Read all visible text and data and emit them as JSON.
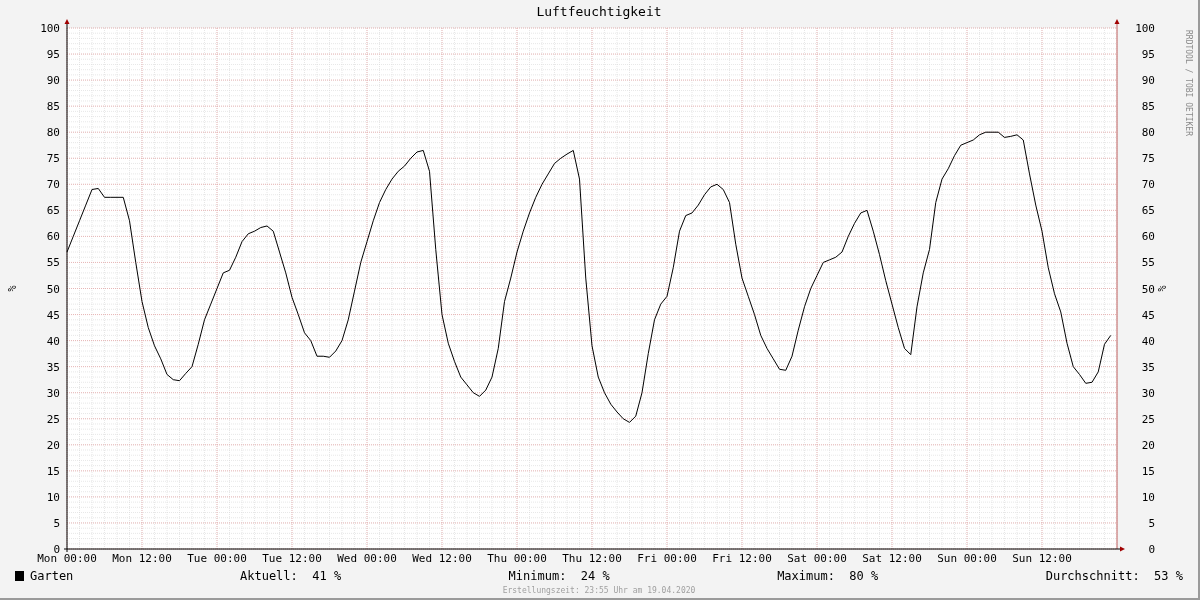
{
  "watermark": "RRDTOOL / TOBI OETIKER",
  "chart_data": {
    "type": "line",
    "title": "Luftfeuchtigkeit",
    "ylabel": "%",
    "ylim": [
      0,
      100
    ],
    "grid": true,
    "yticks": [
      0,
      5,
      10,
      15,
      20,
      25,
      30,
      35,
      40,
      45,
      50,
      55,
      60,
      65,
      70,
      75,
      80,
      85,
      90,
      95,
      100
    ],
    "categories": [
      "Mon 00:00",
      null,
      null,
      null,
      null,
      null,
      null,
      null,
      null,
      null,
      null,
      null,
      "Mon 12:00",
      null,
      null,
      null,
      null,
      null,
      null,
      null,
      null,
      null,
      null,
      null,
      "Tue 00:00",
      null,
      null,
      null,
      null,
      null,
      null,
      null,
      null,
      null,
      null,
      null,
      "Tue 12:00",
      null,
      null,
      null,
      null,
      null,
      null,
      null,
      null,
      null,
      null,
      null,
      "Wed 00:00",
      null,
      null,
      null,
      null,
      null,
      null,
      null,
      null,
      null,
      null,
      null,
      "Wed 12:00",
      null,
      null,
      null,
      null,
      null,
      null,
      null,
      null,
      null,
      null,
      null,
      "Thu 00:00",
      null,
      null,
      null,
      null,
      null,
      null,
      null,
      null,
      null,
      null,
      null,
      "Thu 12:00",
      null,
      null,
      null,
      null,
      null,
      null,
      null,
      null,
      null,
      null,
      null,
      "Fri 00:00",
      null,
      null,
      null,
      null,
      null,
      null,
      null,
      null,
      null,
      null,
      null,
      "Fri 12:00",
      null,
      null,
      null,
      null,
      null,
      null,
      null,
      null,
      null,
      null,
      null,
      "Sat 00:00",
      null,
      null,
      null,
      null,
      null,
      null,
      null,
      null,
      null,
      null,
      null,
      "Sat 12:00",
      null,
      null,
      null,
      null,
      null,
      null,
      null,
      null,
      null,
      null,
      null,
      "Sun 00:00",
      null,
      null,
      null,
      null,
      null,
      null,
      null,
      null,
      null,
      null,
      null,
      "Sun 12:00",
      null,
      null,
      null,
      null,
      null,
      null,
      null,
      null,
      null,
      null,
      null
    ],
    "series": [
      {
        "name": "Garten",
        "color": "#000000",
        "values": [
          57,
          60,
          63,
          66,
          69,
          69.2,
          67.5,
          67.5,
          67.5,
          67.5,
          63,
          55,
          47.5,
          42.5,
          39,
          36.5,
          33.5,
          32.5,
          32.3,
          33.7,
          35,
          39.3,
          44,
          47,
          50,
          53,
          53.5,
          56,
          59,
          60.5,
          61,
          61.7,
          62,
          61,
          57,
          53,
          48.3,
          45,
          41.5,
          40,
          37,
          37,
          36.8,
          38,
          40,
          44,
          49.5,
          55,
          59,
          63,
          66.5,
          69,
          71,
          72.5,
          73.5,
          75,
          76.2,
          76.5,
          72.5,
          57.5,
          45,
          39.5,
          36,
          33,
          31.5,
          30,
          29.3,
          30.5,
          33,
          38.5,
          47.5,
          52,
          57,
          61,
          64.5,
          67.5,
          70,
          72,
          74,
          75,
          75.8,
          76.5,
          71,
          52,
          39,
          33,
          30,
          27.8,
          26.3,
          25,
          24.3,
          25.5,
          30,
          37.5,
          44,
          47,
          48.5,
          54,
          61,
          64,
          64.5,
          66,
          68,
          69.5,
          70,
          69,
          66.5,
          58.5,
          52,
          48.5,
          45,
          41,
          38.5,
          36.5,
          34.5,
          34.3,
          37,
          42,
          46.5,
          50,
          52.5,
          55,
          55.5,
          56,
          57,
          60,
          62.5,
          64.5,
          65,
          61,
          56.5,
          51.5,
          47,
          42.5,
          38.5,
          37.3,
          46.5,
          53,
          57.5,
          66.5,
          71,
          73,
          75.5,
          77.5,
          78,
          78.5,
          79.5,
          80,
          80,
          80,
          79,
          79.2,
          79.5,
          78.5,
          72,
          66,
          61,
          54,
          49,
          45.5,
          39.5,
          35,
          33.5,
          31.8,
          32,
          34,
          39.3,
          41
        ]
      }
    ]
  },
  "right_axis": {
    "label": "%",
    "ticks": [
      "100",
      "95",
      "90",
      "85",
      "80",
      "75",
      "70",
      "65",
      "60",
      "55",
      "50",
      "45",
      "40",
      "35",
      "30",
      "25",
      "20",
      "15",
      "10",
      "5",
      "0"
    ]
  },
  "legend": {
    "stats": [
      {
        "label": "Aktuell:",
        "value": "41 %"
      },
      {
        "label": "Minimum:",
        "value": "24 %"
      },
      {
        "label": "Maximum:",
        "value": "80 %"
      },
      {
        "label": "Durchschnitt:",
        "value": "53 %"
      }
    ]
  },
  "footer": "Erstellungszeit: 23:55 Uhr am 19.04.2020"
}
